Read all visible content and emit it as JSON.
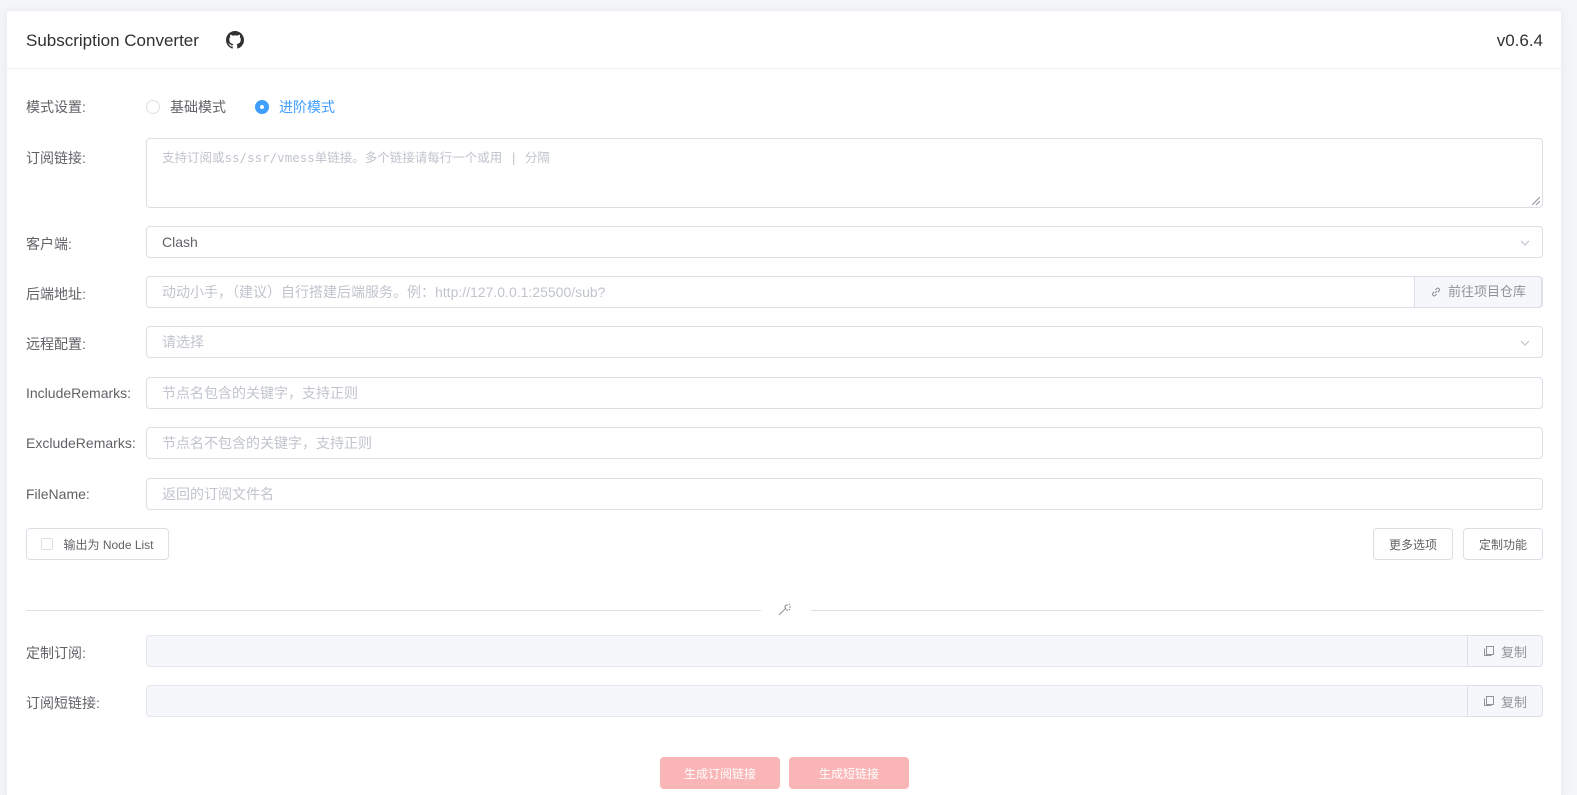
{
  "header": {
    "title": "Subscription Converter",
    "version": "v0.6.4"
  },
  "mode": {
    "label": "模式设置:",
    "options": [
      "基础模式",
      "进阶模式"
    ],
    "selected": "进阶模式"
  },
  "subscription": {
    "label": "订阅链接:",
    "placeholder": "支持订阅或ss/ssr/vmess单链接。多个链接请每行一个或用 | 分隔"
  },
  "client": {
    "label": "客户端:",
    "value": "Clash"
  },
  "backend": {
    "label": "后端地址:",
    "placeholder": "动动小手，（建议）自行搭建后端服务。例：http://127.0.0.1:25500/sub?",
    "repo_button": "前往项目仓库"
  },
  "remote_config": {
    "label": "远程配置:",
    "placeholder": "请选择"
  },
  "include": {
    "label": "IncludeRemarks:",
    "placeholder": "节点名包含的关键字，支持正则"
  },
  "exclude": {
    "label": "ExcludeRemarks:",
    "placeholder": "节点名不包含的关键字，支持正则"
  },
  "filename": {
    "label": "FileName:",
    "placeholder": "返回的订阅文件名"
  },
  "options": {
    "node_list": "输出为 Node List",
    "more": "更多选项",
    "custom": "定制功能"
  },
  "custom_sub": {
    "label": "定制订阅:",
    "copy": "复制"
  },
  "short_link": {
    "label": "订阅短链接:",
    "copy": "复制"
  },
  "actions": {
    "generate_sub": "生成订阅链接",
    "generate_short": "生成短链接"
  },
  "colors": {
    "accent": "#409eff",
    "danger_disabled": "#fab6b6",
    "border": "#dcdfe6"
  }
}
